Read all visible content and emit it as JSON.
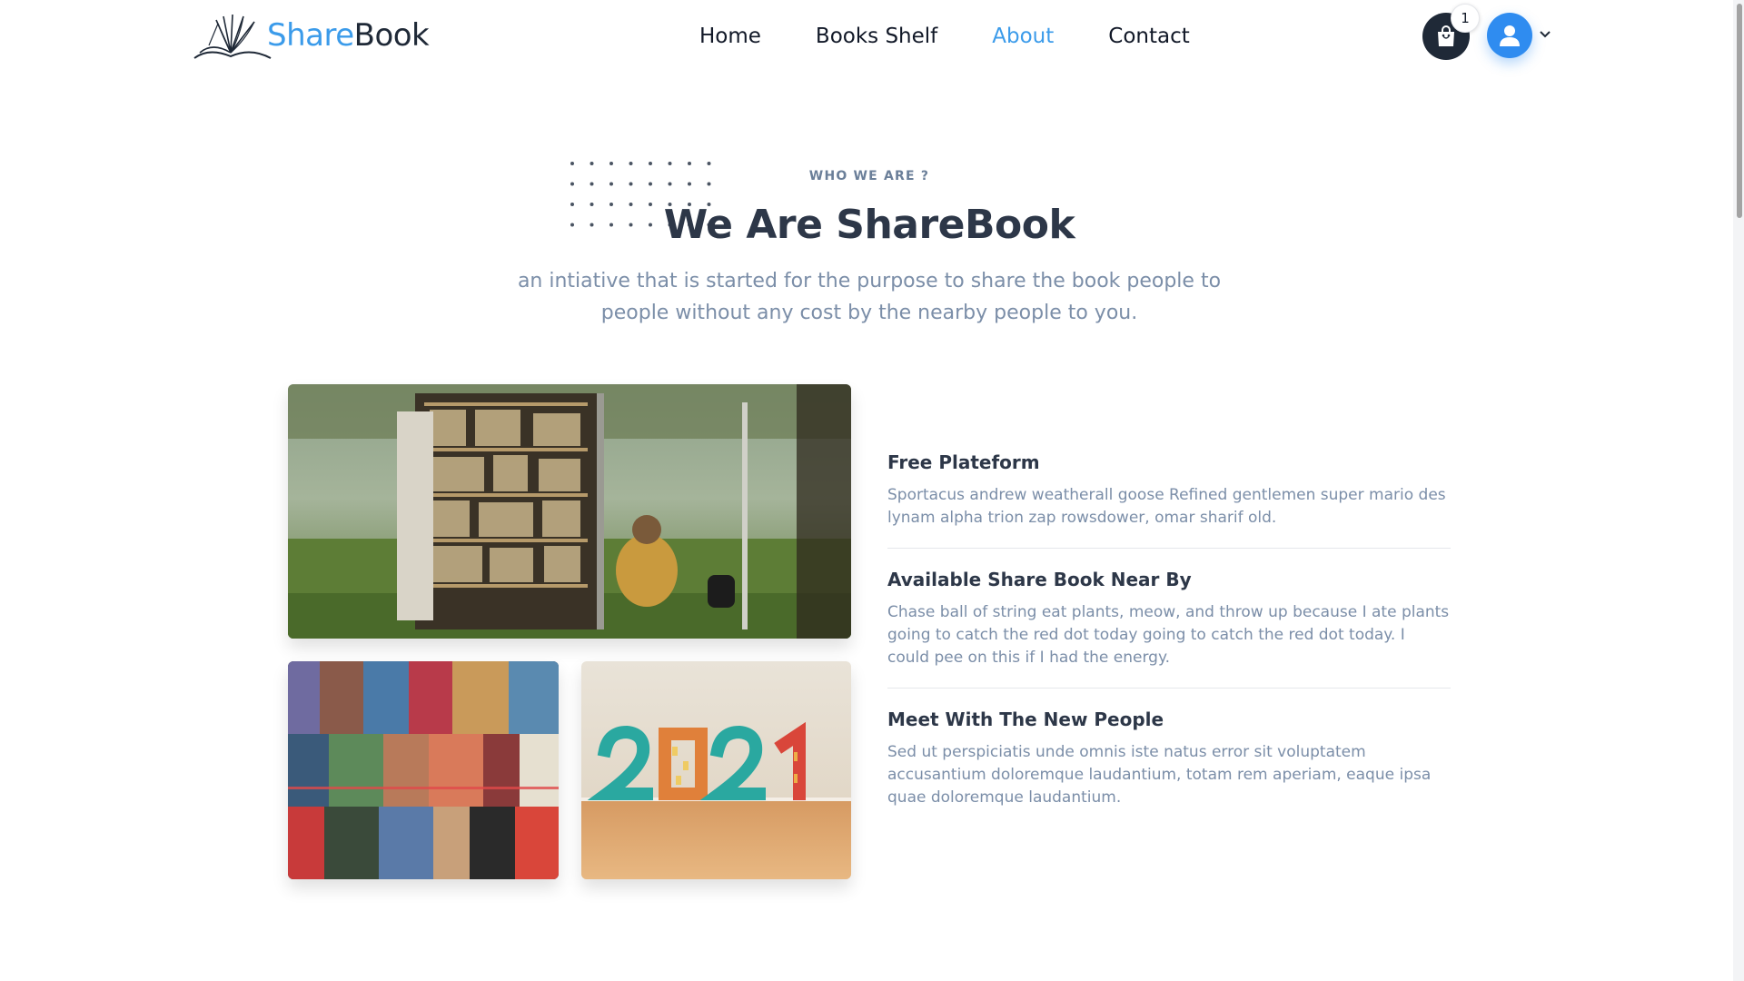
{
  "brand": {
    "share": "Share",
    "book": "Book"
  },
  "nav": {
    "items": [
      {
        "label": "Home",
        "active": false
      },
      {
        "label": "Books Shelf",
        "active": false
      },
      {
        "label": "About",
        "active": true
      },
      {
        "label": "Contact",
        "active": false
      }
    ]
  },
  "cart": {
    "count": "1",
    "icon": "shopping-bag-icon"
  },
  "user": {
    "icon": "user-icon",
    "menu_icon": "chevron-down-icon"
  },
  "hero": {
    "eyebrow": "WHO WE ARE ?",
    "headline": "We Are ShareBook",
    "subtitle": "an intiative that is started for the purpose to share the book people to people without any cost by the nearby people to you."
  },
  "features": [
    {
      "title": "Free Plateform",
      "text": "Sportacus andrew weatherall goose Refined gentlemen super mario des lynam alpha trion zap rowsdower, omar sharif old."
    },
    {
      "title": "Available Share Book Near By",
      "text": "Chase ball of string eat plants, meow, and throw up because I ate plants going to catch the red dot today going to catch the red dot today. I could pee on this if I had the energy."
    },
    {
      "title": "Meet With The New People",
      "text": "Sed ut perspiciatis unde omnis iste natus error sit voluptatem accusantium doloremque laudantium, totam rem aperiam, eaque ipsa quae doloremque laudantium."
    }
  ],
  "colors": {
    "accent": "#3b9bea",
    "dark": "#1f2937",
    "muted": "#7b8ea8"
  }
}
